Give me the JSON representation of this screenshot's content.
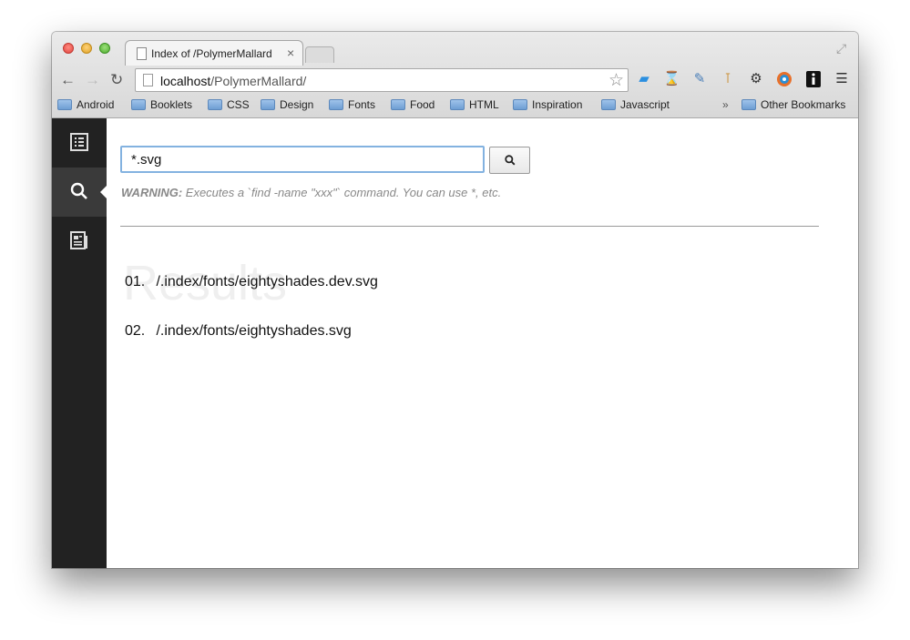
{
  "browser": {
    "tab_title": "Index of /PolymerMallard",
    "tab_close": "×",
    "url_host": "localhost",
    "url_path": "/PolymerMallard/",
    "nav": {
      "back": "←",
      "forward": "→",
      "reload": "↻",
      "star": "☆",
      "fullscreen": "⤢"
    },
    "extensions": [
      "ext-blue-icon",
      "hourglass-icon",
      "eyedropper-icon",
      "pin-icon",
      "gear-icon",
      "target-icon",
      "info-icon",
      "menu-icon"
    ]
  },
  "bookmarks": {
    "items": [
      "Android",
      "Booklets",
      "CSS",
      "Design",
      "Fonts",
      "Food",
      "HTML",
      "Inspiration",
      "Javascript"
    ],
    "overflow": "»",
    "other": "Other Bookmarks"
  },
  "sidebar": {
    "items": [
      "list-icon",
      "search-icon",
      "document-icon"
    ],
    "active": "search-icon"
  },
  "search": {
    "value": "*.svg",
    "warning_label": "WARNING:",
    "warning_text": " Executes a `find -name \"xxx\"` command. You can use *, etc."
  },
  "results": {
    "heading": "Results",
    "items": [
      {
        "num": "01.",
        "path": "/.index/fonts/eightyshades.dev.svg"
      },
      {
        "num": "02.",
        "path": "/.index/fonts/eightyshades.svg"
      }
    ]
  }
}
